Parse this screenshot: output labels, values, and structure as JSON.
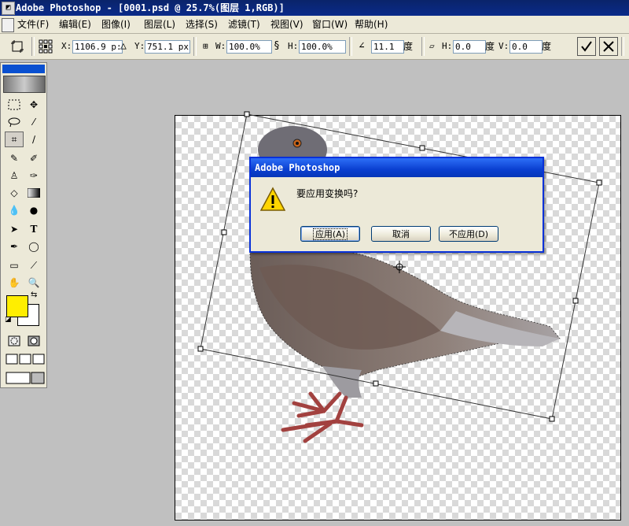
{
  "window": {
    "title": "Adobe Photoshop - [0001.psd @ 25.7%(图层 1,RGB)]"
  },
  "menu": [
    {
      "label": "文件(F)"
    },
    {
      "label": "编辑(E)"
    },
    {
      "label": "图像(I)"
    },
    {
      "label": "图层(L)"
    },
    {
      "label": "选择(S)"
    },
    {
      "label": "滤镜(T)"
    },
    {
      "label": "视图(V)"
    },
    {
      "label": "窗口(W)"
    },
    {
      "label": "帮助(H)"
    }
  ],
  "options": {
    "x_label": "X:",
    "x_value": "1106.9 p:",
    "y_label": "Y:",
    "y_value": "751.1 px",
    "w_label": "W:",
    "w_value": "100.0%",
    "h_label": "H:",
    "h_value": "100.0%",
    "angle_value": "11.1",
    "angle_unit": "度",
    "hskew_label": "H:",
    "hskew_value": "0.0",
    "hskew_unit": "度",
    "vskew_label": "V:",
    "vskew_value": "0.0"
  },
  "dialog": {
    "title": "Adobe Photoshop",
    "message": "要应用变换吗?",
    "buttons": {
      "apply": "应用(A)",
      "cancel": "取消",
      "dont_apply": "不应用(D)"
    }
  },
  "colors": {
    "foreground": "#ffee00",
    "background": "#ffffff",
    "dialog_title": "#0a3fd0"
  }
}
